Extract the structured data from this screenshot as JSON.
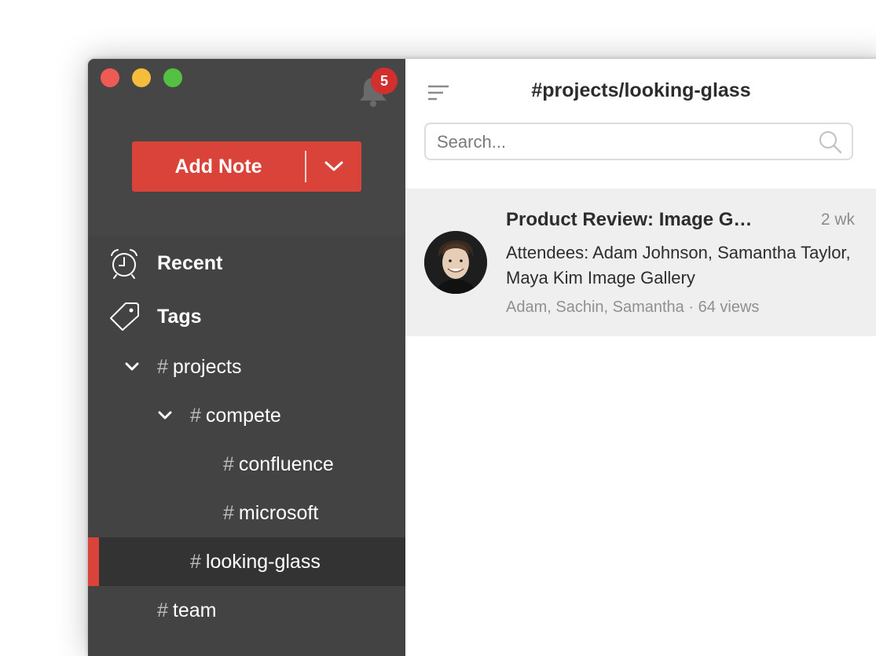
{
  "colors": {
    "accent": "#d9433a",
    "badge": "#d22f2f",
    "traffic_close": "#ee5b54",
    "traffic_minimize": "#f5bd3b",
    "traffic_zoom": "#55c142"
  },
  "notifications": {
    "icon": "bell-icon",
    "count": "5"
  },
  "add_note": {
    "label": "Add Note",
    "dropdown_icon": "chevron-down-icon"
  },
  "sidebar": {
    "recent": {
      "label": "Recent",
      "icon": "alarm-clock-icon"
    },
    "tags": {
      "label": "Tags",
      "icon": "tag-icon"
    },
    "tag_tree": [
      {
        "label": "projects",
        "expanded": true
      },
      {
        "label": "compete",
        "expanded": true
      },
      {
        "label": "confluence"
      },
      {
        "label": "microsoft"
      },
      {
        "label": "looking-glass",
        "selected": true
      },
      {
        "label": "team"
      }
    ],
    "hash_symbol": "#"
  },
  "main": {
    "title": "#projects/looking-glass",
    "sort_icon": "sort-lines-icon",
    "search": {
      "placeholder": "Search...",
      "value": "",
      "icon": "search-icon"
    },
    "notes": [
      {
        "title": "Product Review: Image G…",
        "time": "2 wk",
        "body": "Attendees: Adam Johnson, Samantha Taylor, Maya Kim Image Gallery",
        "meta": "Adam, Sachin, Samantha · 64 views"
      }
    ]
  }
}
